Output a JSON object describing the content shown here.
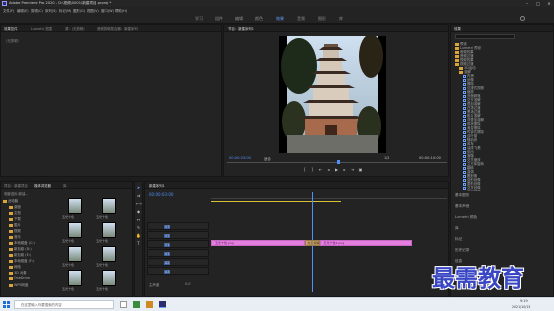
{
  "titlebar": {
    "title": "Adobe Premiere Pro 2020 - D:\\视频\\0001\\新建项目.prproj *"
  },
  "menu": [
    "文件(F)",
    "编辑(E)",
    "剪辑(C)",
    "序列(S)",
    "标记(M)",
    "图形(G)",
    "视图(V)",
    "窗口(W)",
    "帮助(H)"
  ],
  "workspaces": [
    "学习",
    "组件",
    "编辑",
    "颜色",
    "效果",
    "音频",
    "图形",
    "库"
  ],
  "source_panel": {
    "tabs": [
      "效果控件",
      "Lumetri 范围",
      "源：(无剪辑)",
      "音频剪辑混合器：新建序列"
    ],
    "tag": "（无剪辑）"
  },
  "program_monitor": {
    "tab": "节目：新建序列1",
    "timecode_left": "00:00:03:00",
    "fit": "适合",
    "quality": "1/2",
    "timecode_right": "00:00:10:00"
  },
  "effects_panel": {
    "tab": "效果",
    "items": [
      {
        "label": "预设",
        "kind": "folder",
        "indent": 1
      },
      {
        "label": "Lumetri 预设",
        "kind": "folder",
        "indent": 1
      },
      {
        "label": "音频效果",
        "kind": "folder",
        "indent": 1
      },
      {
        "label": "音频过渡",
        "kind": "folder",
        "indent": 1
      },
      {
        "label": "视频效果",
        "kind": "folder",
        "indent": 1
      },
      {
        "label": "视频过渡",
        "kind": "folder",
        "indent": 1
      },
      {
        "label": "3D运动",
        "kind": "folder",
        "indent": 2
      },
      {
        "label": "溶解",
        "kind": "folder",
        "indent": 2
      },
      {
        "label": "内滑",
        "kind": "fx",
        "indent": 3
      },
      {
        "label": "划像",
        "kind": "fx",
        "indent": 3
      },
      {
        "label": "擦除",
        "kind": "fx",
        "indent": 3
      },
      {
        "label": "沉浸式视频",
        "kind": "fx",
        "indent": 3
      },
      {
        "label": "缩放",
        "kind": "fx",
        "indent": 3
      },
      {
        "label": "页面剥落",
        "kind": "fx",
        "indent": 3
      },
      {
        "label": "交叉溶解",
        "kind": "fx",
        "indent": 3
      },
      {
        "label": "叠加溶解",
        "kind": "fx",
        "indent": 3
      },
      {
        "label": "白场过渡",
        "kind": "fx",
        "indent": 3
      },
      {
        "label": "黑场过渡",
        "kind": "fx",
        "indent": 3
      },
      {
        "label": "胶片溶解",
        "kind": "fx",
        "indent": 3
      },
      {
        "label": "非叠加溶解",
        "kind": "fx",
        "indent": 3
      },
      {
        "label": "带状擦除",
        "kind": "fx",
        "indent": 3
      },
      {
        "label": "渐变擦除",
        "kind": "fx",
        "indent": 3
      },
      {
        "label": "时钟式擦除",
        "kind": "fx",
        "indent": 3
      },
      {
        "label": "百叶窗",
        "kind": "fx",
        "indent": 3
      },
      {
        "label": "随机块",
        "kind": "fx",
        "indent": 3
      },
      {
        "label": "风车",
        "kind": "fx",
        "indent": 3
      },
      {
        "label": "油漆飞溅",
        "kind": "fx",
        "indent": 3
      },
      {
        "label": "划出",
        "kind": "fx",
        "indent": 3
      },
      {
        "label": "渐隐",
        "kind": "fx",
        "indent": 3
      },
      {
        "label": "交叉缩放",
        "kind": "fx",
        "indent": 3
      },
      {
        "label": "立方体旋转",
        "kind": "fx",
        "indent": 3
      },
      {
        "label": "翻转",
        "kind": "fx",
        "indent": 3
      },
      {
        "label": "漩涡",
        "kind": "fx",
        "indent": 3
      },
      {
        "label": "圆划像",
        "kind": "fx",
        "indent": 3
      },
      {
        "label": "盒形划像",
        "kind": "fx",
        "indent": 3
      },
      {
        "label": "菱形划像",
        "kind": "fx",
        "indent": 3
      },
      {
        "label": "交叉划像",
        "kind": "fx",
        "indent": 3
      },
      {
        "label": "页面剥落",
        "kind": "fx",
        "indent": 3
      }
    ],
    "sections": [
      "基本图形",
      "基本声音",
      "Lumetri 颜色",
      "库",
      "标记",
      "历史记录",
      "信息"
    ]
  },
  "project_panel": {
    "tabs": [
      "项目：新建项目",
      "媒体浏览器",
      "库"
    ],
    "path": "电脑\\图片\\新建...",
    "tree": [
      "此电脑",
      "桌面",
      "文档",
      "下载",
      "图片",
      "视频",
      "音乐",
      "本地磁盘 (C:)",
      "新加卷 (D:)",
      "新加卷 (E:)",
      "本地磁盘 (F:)",
      "网络",
      "3D 对象",
      "OneDrive",
      "WPS网盘"
    ],
    "thumbs": [
      "五光十色",
      "五光十色",
      "五光十色",
      "五光十色",
      "五光十色",
      "五光十色",
      "五光十色",
      "五光十色"
    ]
  },
  "timeline": {
    "tab": "新建序列1",
    "timecode": "00:00:03:00",
    "tracks": [
      "V3",
      "V2",
      "V1",
      "A1",
      "A2",
      "A3"
    ],
    "mix": "主声道",
    "mix_value": "0.0",
    "clips": [
      {
        "label": "五光十色.png",
        "start": 0,
        "end": 0.4
      },
      {
        "label": "交叉溶解",
        "start": 0.4,
        "end": 0.46
      },
      {
        "label": "五光十色2.png",
        "start": 0.46,
        "end": 0.85
      }
    ],
    "playhead": 0.43
  },
  "watermark": {
    "text": "最需教育"
  },
  "taskbar": {
    "search_placeholder": "在这里输入你要搜索的内容",
    "time": "9:19",
    "date": "2021/10/15"
  }
}
